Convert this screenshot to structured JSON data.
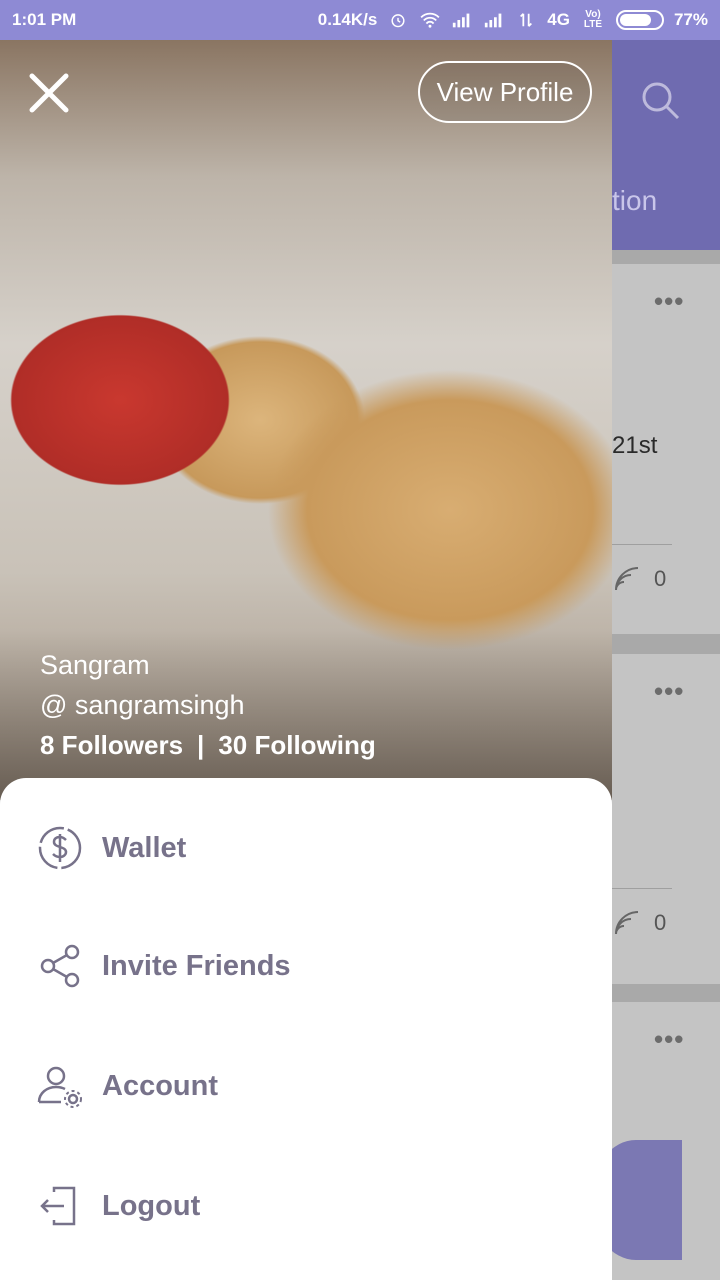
{
  "status_bar": {
    "time": "1:01 PM",
    "speed": "0.14K/s",
    "network": "4G",
    "volte": "VoLTE",
    "battery": "77%",
    "battery_level": 0.77
  },
  "background": {
    "tab_fragment": "tion",
    "cards": [
      {
        "menu": "•••",
        "text": "21st",
        "count": "0"
      },
      {
        "menu": "•••",
        "count": "0"
      },
      {
        "menu": "•••"
      }
    ]
  },
  "drawer": {
    "view_profile_label": "View Profile",
    "profile": {
      "name": "Sangram",
      "handle": "@ sangramsingh",
      "followers": "8 Followers",
      "separator": "|",
      "following": "30 Following"
    },
    "menu": [
      {
        "label": "Wallet",
        "icon": "wallet-dollar-icon"
      },
      {
        "label": "Invite Friends",
        "icon": "share-icon"
      },
      {
        "label": "Account",
        "icon": "account-settings-icon"
      },
      {
        "label": "Logout",
        "icon": "logout-icon"
      }
    ]
  },
  "colors": {
    "accent": "#8e8ad4",
    "menu_text": "#77728a"
  }
}
